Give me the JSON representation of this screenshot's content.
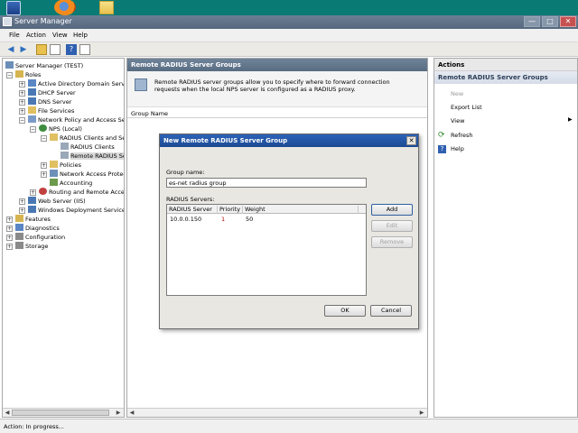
{
  "window": {
    "title": "Server Manager",
    "controls": {
      "minimize": "—",
      "maximize": "□",
      "close": "✕"
    }
  },
  "menu": [
    "File",
    "Action",
    "View",
    "Help"
  ],
  "tree": {
    "root": "Server Manager (TEST)",
    "roles": "Roles",
    "items": [
      "Active Directory Domain Servic",
      "DHCP Server",
      "DNS Server",
      "File Services",
      "Network Policy and Access Serv",
      "NPS (Local)",
      "RADIUS Clients and Ser",
      "RADIUS Clients",
      "Remote RADIUS Se",
      "Policies",
      "Network Access Protect",
      "Accounting",
      "Routing and Remote Access",
      "Web Server (IIS)",
      "Windows Deployment Services",
      "Features",
      "Diagnostics",
      "Configuration",
      "Storage"
    ]
  },
  "main": {
    "header": "Remote RADIUS Server Groups",
    "description": "Remote RADIUS server groups allow you to specify where to forward connection requests when the local NPS server is configured as a RADIUS proxy.",
    "column": "Group Name"
  },
  "actions": {
    "title": "Actions",
    "group": "Remote RADIUS Server Groups",
    "items": [
      "New",
      "Export List",
      "View",
      "Refresh",
      "Help"
    ]
  },
  "dialog": {
    "title": "New Remote RADIUS Server Group",
    "group_name_label": "Group name:",
    "group_name_value": "es-net radius group",
    "servers_label": "RADIUS Servers:",
    "columns": [
      "RADIUS Server",
      "Priority",
      "Weight"
    ],
    "rows": [
      {
        "server": "10.0.0.150",
        "priority": "1",
        "weight": "50"
      }
    ],
    "buttons": {
      "add": "Add",
      "edit": "Edit",
      "remove": "Remove",
      "ok": "OK",
      "cancel": "Cancel"
    }
  },
  "status": "Action:  In progress..."
}
